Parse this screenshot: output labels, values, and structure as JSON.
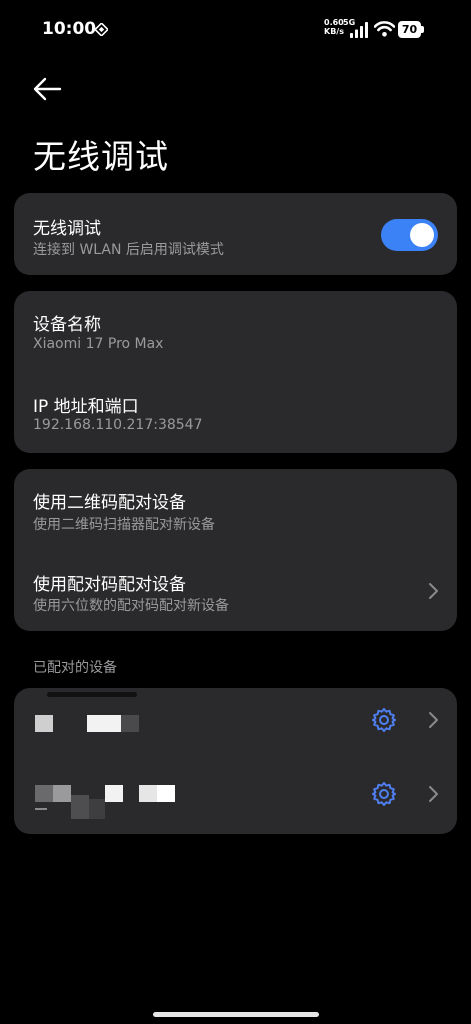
{
  "status_bar": {
    "time": "10:00",
    "net_speed_value": "0.60",
    "net_speed_unit": "KB/s",
    "network_type": "5G",
    "battery_level": "70",
    "icons": [
      "data-saver-icon",
      "signal-icon",
      "wifi-icon",
      "battery-icon"
    ]
  },
  "header": {
    "back_icon": "arrow-left-icon",
    "title": "无线调试"
  },
  "wireless_debugging": {
    "title": "无线调试",
    "subtitle": "连接到 WLAN 后启用调试模式",
    "enabled": true
  },
  "device_info": {
    "name_label": "设备名称",
    "name_value": "Xiaomi 17 Pro Max",
    "ip_label": "IP 地址和端口",
    "ip_value": "192.168.110.217:38547"
  },
  "pairing": {
    "qr_title": "使用二维码配对设备",
    "qr_subtitle": "使用二维码扫描器配对新设备",
    "code_title": "使用配对码配对设备",
    "code_subtitle": "使用六位数的配对码配对新设备"
  },
  "paired_devices": {
    "section_label": "已配对的设备",
    "items": [
      {
        "icon": "gear-icon",
        "name_redacted": true
      },
      {
        "icon": "gear-icon",
        "name_redacted": true
      }
    ]
  },
  "colors": {
    "background": "#000000",
    "card": "#2a2a2c",
    "accent": "#3b82f6",
    "subtext": "#9a9a9d"
  }
}
